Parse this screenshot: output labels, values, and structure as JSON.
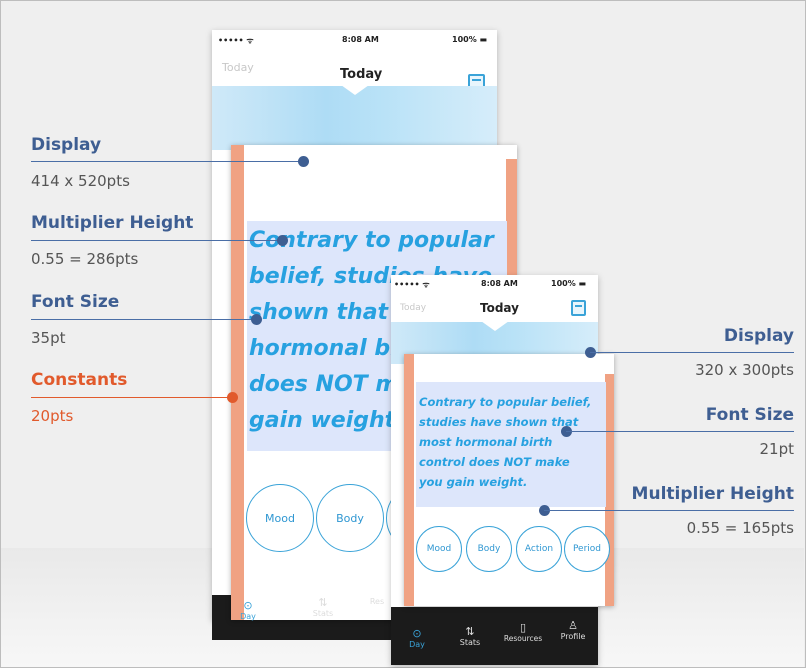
{
  "annotations_left": {
    "display": {
      "title": "Display",
      "value": "414 x 520pts"
    },
    "multiplier_height": {
      "title": "Multiplier Height",
      "value": "0.55 = 286pts"
    },
    "font_size": {
      "title": "Font Size",
      "value": "35pt"
    },
    "constants": {
      "title": "Constants",
      "value": "20pts"
    }
  },
  "annotations_right": {
    "display": {
      "title": "Display",
      "value": "320 x 300pts"
    },
    "font_size": {
      "title": "Font Size",
      "value": "21pt"
    },
    "multiplier_height": {
      "title": "Multiplier Height",
      "value": "0.55 = 165pts"
    }
  },
  "large_phone": {
    "status": {
      "carrier": "••••• ᯤ",
      "time": "8:08 AM",
      "battery": "100% ▬"
    },
    "nav": {
      "left": "Today",
      "title": "Today"
    },
    "quote_lines": [
      "Contrary to popular",
      "belief, studies have",
      "shown that m",
      "hormonal bi",
      "does NOT m",
      "gain weight."
    ],
    "mood_buttons": [
      "Mood",
      "Body"
    ],
    "tabs": [
      {
        "icon": "⊙",
        "label": "Day"
      },
      {
        "icon": "⇅",
        "label": "Stats"
      },
      {
        "icon": "",
        "label": "Res"
      }
    ]
  },
  "small_phone": {
    "status": {
      "carrier": "••••• ᯤ",
      "time": "8:08 AM",
      "battery": "100% ▬"
    },
    "nav": {
      "left": "Today",
      "title": "Today"
    },
    "quote_lines": [
      "Contrary to popular belief,",
      "studies have shown that",
      "most hormonal birth",
      "control does NOT make",
      "you gain weight."
    ],
    "mood_buttons": [
      "Mood",
      "Body",
      "Action",
      "Period"
    ],
    "tabs": [
      {
        "icon": "⊙",
        "label": "Day"
      },
      {
        "icon": "⇅",
        "label": "Stats"
      },
      {
        "icon": "▯",
        "label": "Resources"
      },
      {
        "icon": "♙",
        "label": "Profile"
      }
    ]
  },
  "colors": {
    "accent": "#3aa3d8",
    "annotation": "#3e5e92",
    "constant": "#e15a2c",
    "edge_bar": "#f0a283"
  }
}
